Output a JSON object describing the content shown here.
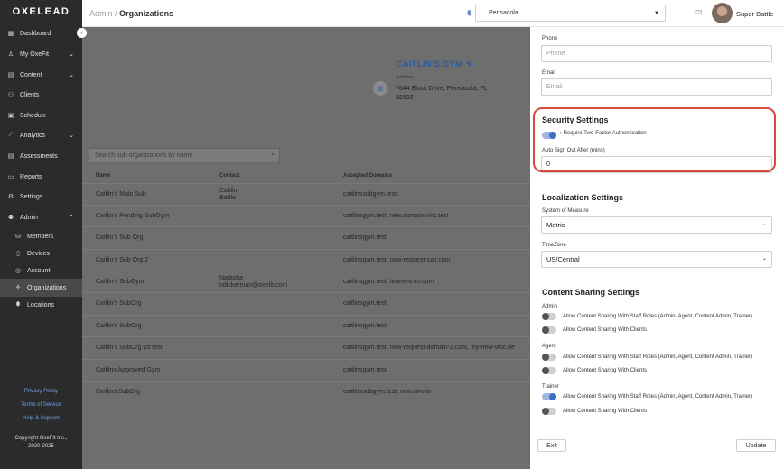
{
  "brand": {
    "logo": "OXELEAD"
  },
  "sidebar": {
    "items": [
      {
        "label": "Dashboard",
        "icon": "grid-icon",
        "glyph": "▦"
      },
      {
        "label": "My OxeFit",
        "icon": "person-icon",
        "glyph": "♙"
      },
      {
        "label": "Content",
        "icon": "content-icon",
        "glyph": "▤"
      },
      {
        "label": "Clients",
        "icon": "clients-icon",
        "glyph": "⚇"
      },
      {
        "label": "Schedule",
        "icon": "calendar-icon",
        "glyph": "▣"
      },
      {
        "label": "Analytics",
        "icon": "chart-icon",
        "glyph": "⟋"
      },
      {
        "label": "Assessments",
        "icon": "clipboard-icon",
        "glyph": "▤"
      },
      {
        "label": "Reports",
        "icon": "folder-icon",
        "glyph": "▭"
      },
      {
        "label": "Settings",
        "icon": "gear-icon",
        "glyph": "⚙"
      },
      {
        "label": "Admin",
        "icon": "admin-icon",
        "glyph": "⚉"
      }
    ],
    "sub_items": [
      {
        "label": "Members",
        "icon": "members-icon",
        "glyph": "⛁"
      },
      {
        "label": "Devices",
        "icon": "device-icon",
        "glyph": "▯"
      },
      {
        "label": "Account",
        "icon": "account-icon",
        "glyph": "◎"
      },
      {
        "label": "Organizations",
        "icon": "organizations-icon",
        "glyph": "⚘"
      },
      {
        "label": "Locations",
        "icon": "location-icon",
        "glyph": "⬮"
      }
    ],
    "privacy": "Privacy Policy",
    "terms": "Terms of Service",
    "help": "Help & Support",
    "copyright_1": "Copyright OxeFit Inc.,",
    "copyright_2": "2020-2025"
  },
  "topbar": {
    "crumb_root": "Admin",
    "crumb_sep": "/",
    "crumb_current": "Organizations",
    "location": "Pensacola",
    "user": "Super Battle"
  },
  "org": {
    "name": "CAITLIN'S GYM",
    "address_label": "Address",
    "address": "7644 Block Drive, Pensacola, FL 32502"
  },
  "search": {
    "placeholder": "Search sub-organizations by name"
  },
  "table": {
    "headers": [
      "Name",
      "Contact",
      "Accepted Domains"
    ],
    "rows": [
      {
        "name": "Caitlin's Main Sub",
        "contact1": "Caitlin",
        "contact2": "Battle",
        "domains": "caitlinssubgym.test"
      },
      {
        "name": "Caitlin's Pending SubGym",
        "contact1": "",
        "contact2": "",
        "domains": "caitlinsgym.test, new.domain.vinc.test"
      },
      {
        "name": "Caitlin's Sub Org",
        "contact1": "",
        "contact2": "",
        "domains": "caitlinsgym.test"
      },
      {
        "name": "Caitlin's Sub Org 2",
        "contact1": "",
        "contact2": "",
        "domains": "caitlinsgym.test, new-request-cait.com"
      },
      {
        "name": "Caitlin's SubGym",
        "contact1": "Natasha",
        "contact2": "ndickerman@oxefit.com",
        "domains": "caitlinsgym.test, timevinc-io.com"
      },
      {
        "name": "Caitlin's SubOrg",
        "contact1": "",
        "contact2": "",
        "domains": "caitlinsgym.test"
      },
      {
        "name": "Caitlin's SubOrg",
        "contact1": "",
        "contact2": "",
        "domains": "caitlinsgym.test"
      },
      {
        "name": "Caitlin's SubOrg DzTest",
        "contact1": "",
        "contact2": "",
        "domains": "caitlinsgym.test, new-request-domain-2.com, my-new-vinc.de"
      },
      {
        "name": "Caitlins Approved Gym",
        "contact1": "",
        "contact2": "",
        "domains": "caitlinsgym.test"
      },
      {
        "name": "Caitlins SubOrg",
        "contact1": "",
        "contact2": "",
        "domains": "caitlinssubgym.test, new.cmv.io"
      }
    ]
  },
  "panel": {
    "phone_label": "Phone",
    "phone_placeholder": "Phone",
    "email_label": "Email",
    "email_placeholder": "Email",
    "security_title": "Security Settings",
    "two_factor_label": "Require Two-Factor Authentication",
    "two_factor_on": true,
    "auto_signout_label": "Auto Sign Out After (mins)",
    "auto_signout_value": "0",
    "localization_title": "Localization Settings",
    "measure_label": "System of Measure",
    "measure_value": "Metric",
    "timezone_label": "TimeZone",
    "timezone_value": "US/Central",
    "sharing_title": "Content Sharing Settings",
    "groups": [
      {
        "name": "Admin",
        "staff_label": "Allow Content Sharing With Staff Roles (Admin, Agent, Content Admin, Trainer)",
        "staff_on": false,
        "clients_label": "Allow Content Sharing With Clients",
        "clients_on": false
      },
      {
        "name": "Agent",
        "staff_label": "Allow Content Sharing With Staff Roles (Admin, Agent, Content Admin, Trainer)",
        "staff_on": false,
        "clients_label": "Allow Content Sharing With Clients",
        "clients_on": false
      },
      {
        "name": "Trainer",
        "staff_label": "Allow Content Sharing With Staff Roles (Admin, Agent, Content Admin, Trainer)",
        "staff_on": true,
        "clients_label": "Allow Content Sharing With Clients",
        "clients_on": false
      }
    ],
    "exit_label": "Exit",
    "update_label": "Update"
  },
  "colors": {
    "accent": "#3d6fc4",
    "highlight": "#d64a3a",
    "sidebar": "#2b2b2b"
  }
}
